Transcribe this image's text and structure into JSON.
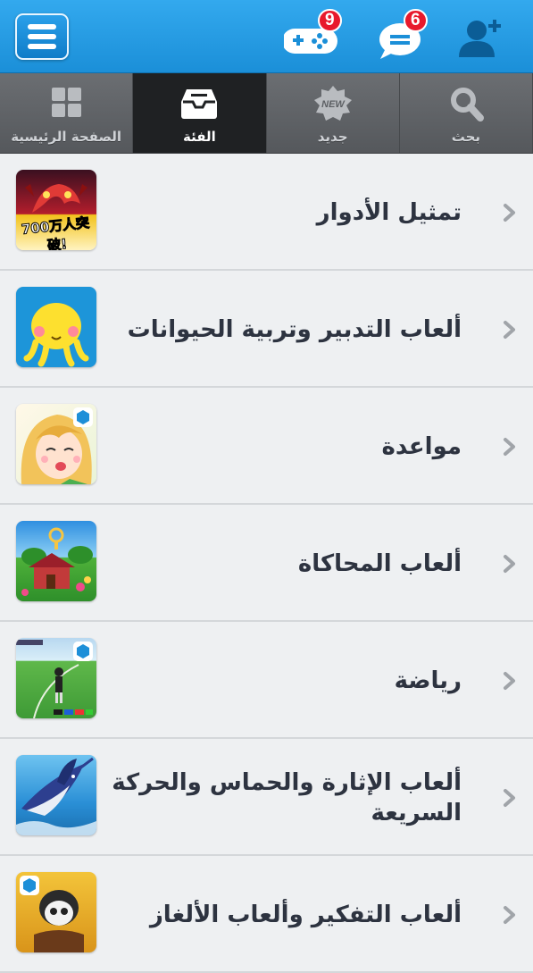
{
  "header": {
    "menu_icon": "hamburger-menu-icon",
    "game_badge": "9",
    "message_badge": "6",
    "icons": [
      "gamepad-icon",
      "chat-bubble-icon",
      "add-user-icon"
    ],
    "accent": "#1f97e0"
  },
  "tabs": [
    {
      "label": "الصفحة الرئيسية",
      "icon": "grid-icon",
      "active": false
    },
    {
      "label": "الفئة",
      "icon": "inbox-icon",
      "active": true
    },
    {
      "label": "جديد",
      "icon": "new-badge-icon",
      "active": false
    },
    {
      "label": "بحث",
      "icon": "search-icon",
      "active": false
    }
  ],
  "categories": [
    {
      "label": "تمثيل الأدوار"
    },
    {
      "label": "ألعاب التدبير وتربية الحيوانات"
    },
    {
      "label": "مواعدة"
    },
    {
      "label": "ألعاب المحاكاة"
    },
    {
      "label": "رياضة"
    },
    {
      "label": "ألعاب الإثارة والحماس والحركة السريعة"
    },
    {
      "label": "ألعاب التفكير وألعاب الألغاز"
    }
  ],
  "thumb_text": {
    "rpg": "700万人突破!"
  }
}
